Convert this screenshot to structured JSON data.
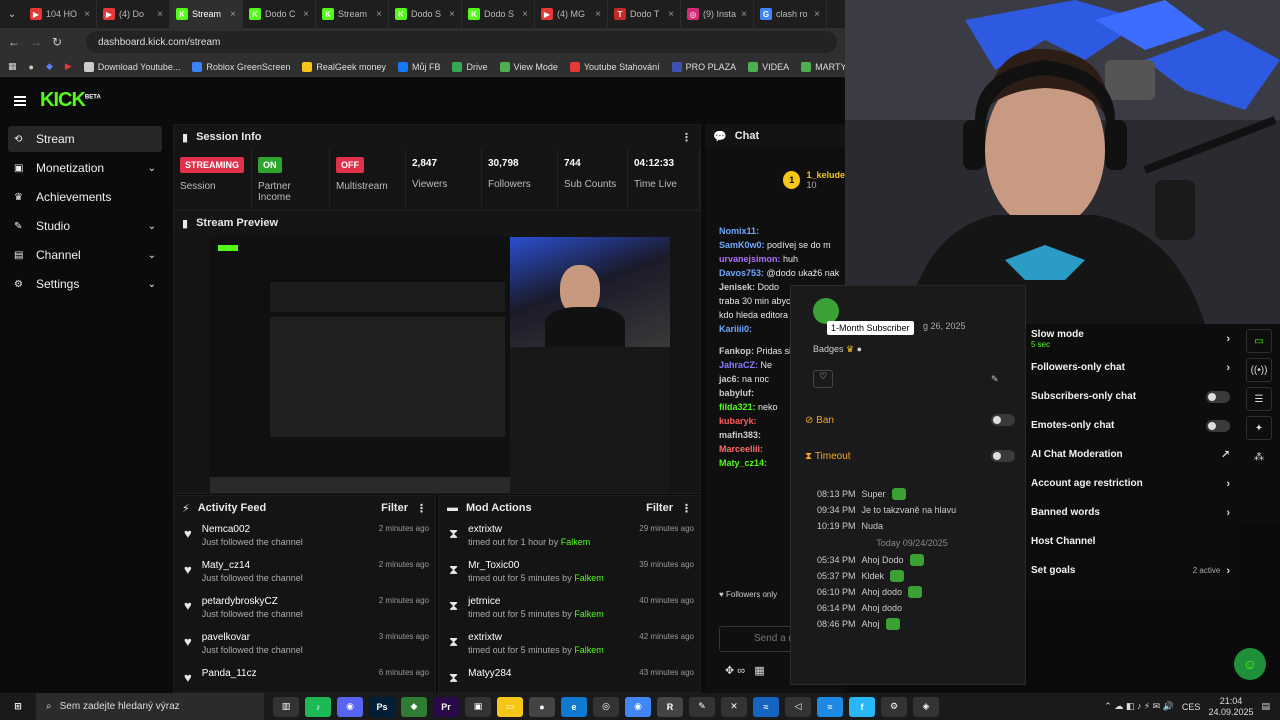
{
  "tabs": [
    {
      "label": "104 HO",
      "color": "#e53935",
      "glyph": "▶"
    },
    {
      "label": "(4) Do",
      "color": "#e53935",
      "glyph": "▶"
    },
    {
      "label": "Stream",
      "color": "#53fc18",
      "glyph": "K",
      "active": true
    },
    {
      "label": "Dodo C",
      "color": "#53fc18",
      "glyph": "K"
    },
    {
      "label": "Stream",
      "color": "#53fc18",
      "glyph": "K"
    },
    {
      "label": "Dodo S",
      "color": "#53fc18",
      "glyph": "K"
    },
    {
      "label": "Dodo S",
      "color": "#53fc18",
      "glyph": "K"
    },
    {
      "label": "(4) MG",
      "color": "#e53935",
      "glyph": "▶"
    },
    {
      "label": "Dodo T",
      "color": "#c62828",
      "glyph": "T"
    },
    {
      "label": "(9) Insta",
      "color": "#d62976",
      "glyph": "◎"
    },
    {
      "label": "clash ro",
      "color": "#4285f4",
      "glyph": "G"
    }
  ],
  "url": "dashboard.kick.com/stream",
  "bookmarks": [
    "Download Youtube...",
    "Roblox GreenScreen",
    "RealGeek money",
    "Můj FB",
    "Drive",
    "View Mode",
    "Youtube Stahování",
    "PRO PLAZA",
    "VIDEA",
    "MARTY UKO"
  ],
  "sidebar": [
    {
      "label": "Stream",
      "icon": "⟲",
      "sel": true,
      "chev": false
    },
    {
      "label": "Monetization",
      "icon": "▣",
      "chev": true
    },
    {
      "label": "Achievements",
      "icon": "♛",
      "chev": false
    },
    {
      "label": "Studio",
      "icon": "✎",
      "chev": true
    },
    {
      "label": "Channel",
      "icon": "▤",
      "chev": true
    },
    {
      "label": "Settings",
      "icon": "⚙",
      "chev": true
    }
  ],
  "session": {
    "title": "Session Info",
    "stats": [
      {
        "pill": "STREAMING",
        "pillColor": "#e0304a",
        "label": "Session"
      },
      {
        "pill": "ON",
        "pillColor": "#2ea62e",
        "label": "Partner Income"
      },
      {
        "pill": "OFF",
        "pillColor": "#e0304a",
        "label": "Multistream"
      },
      {
        "value": "2,847",
        "label": "Viewers"
      },
      {
        "value": "30,798",
        "label": "Followers"
      },
      {
        "value": "744",
        "label": "Sub Counts"
      },
      {
        "value": "04:12:33",
        "label": "Time Live"
      }
    ]
  },
  "preview": {
    "title": "Stream Preview"
  },
  "activity": {
    "title": "Activity Feed",
    "filter": "Filter",
    "rows": [
      {
        "name": "Nemca002",
        "sub": "Just followed the channel",
        "time": "2 minutes ago"
      },
      {
        "name": "Maty_cz14",
        "sub": "Just followed the channel",
        "time": "2 minutes ago"
      },
      {
        "name": "petardybroskyCZ",
        "sub": "Just followed the channel",
        "time": "2 minutes ago"
      },
      {
        "name": "pavelkovar",
        "sub": "Just followed the channel",
        "time": "3 minutes ago"
      },
      {
        "name": "Panda_11cz",
        "sub": "",
        "time": "6 minutes ago"
      }
    ]
  },
  "mod": {
    "title": "Mod Actions",
    "filter": "Filter",
    "rows": [
      {
        "name": "extrixtw",
        "pre": "timed out for 1 hour by",
        "by": "Falkem",
        "time": "29 minutes ago"
      },
      {
        "name": "Mr_Toxic00",
        "pre": "timed out for 5 minutes by",
        "by": "Falkem",
        "time": "39 minutes ago"
      },
      {
        "name": "jetrnice",
        "pre": "timed out for 5 minutes by",
        "by": "Falkem",
        "time": "40 minutes ago"
      },
      {
        "name": "extrixtw",
        "pre": "timed out for 5 minutes by",
        "by": "Falkem",
        "time": "42 minutes ago"
      },
      {
        "name": "Matyy284",
        "pre": "",
        "by": "",
        "time": "43 minutes ago"
      }
    ]
  },
  "chat": {
    "title": "Chat",
    "pinned_user": "1_kelude",
    "pinned_count": "10",
    "lines": [
      {
        "user": "Nomix11:",
        "color": "#6ea8ff",
        "text": ""
      },
      {
        "user": "SamK0w0:",
        "color": "#6ea8ff",
        "text": "podívej se do m"
      },
      {
        "user": "urvanejsimon:",
        "color": "#b06cff",
        "text": "huh"
      },
      {
        "user": "Davos753:",
        "color": "#6ea8ff",
        "text": "@dodo ukaž6 nak"
      },
      {
        "user": "Jenisek:",
        "color": "#ccc",
        "text": "Dodo"
      },
      {
        "user": "",
        "color": "#ccc",
        "text": "traba 30 min abyc"
      },
      {
        "user": "",
        "color": "#ccc",
        "text": "kdo hleda editora"
      },
      {
        "user": "Kariiii0:",
        "color": "#6ea8ff",
        "text": ""
      },
      {
        "user": "",
        "color": "#ccc",
        "text": ""
      },
      {
        "user": "",
        "color": "#ccc",
        "text": ""
      },
      {
        "user": "Fankop:",
        "color": "#ccc",
        "text": "Pridas si"
      },
      {
        "user": "JahraCZ:",
        "color": "#8a7cff",
        "text": "Ne"
      },
      {
        "user": "jac6:",
        "color": "#ccc",
        "text": "na noc"
      },
      {
        "user": "babyluf:",
        "color": "#ccc",
        "text": ""
      },
      {
        "user": "filda321:",
        "color": "#53fc18",
        "text": "neko"
      },
      {
        "user": "kubaryk:",
        "color": "#ff5a5a",
        "text": ""
      },
      {
        "user": "mafin383:",
        "color": "#ccc",
        "text": ""
      },
      {
        "user": "Marceeliii:",
        "color": "#ff6b6b",
        "text": ""
      },
      {
        "user": "Maty_cz14:",
        "color": "#53fc18",
        "text": ""
      }
    ],
    "followers_only": "Followers only",
    "send_placeholder": "Send a m"
  },
  "popup": {
    "tooltip": "1-Month Subscriber",
    "date": "g 26, 2025",
    "badges": "Badges",
    "ban": "Ban",
    "timeout": "Timeout",
    "today": "Today 09/24/2025",
    "msgs": [
      {
        "time": "08:13 PM",
        "text": "Super"
      },
      {
        "time": "09:34 PM",
        "text": "Je to takzvaně na hlavu"
      },
      {
        "time": "10:19 PM",
        "text": "Nuda"
      },
      {
        "time": "05:34 PM",
        "text": "Ahoj Dodo"
      },
      {
        "time": "05:37 PM",
        "text": "Kldek"
      },
      {
        "time": "06:10 PM",
        "text": "Ahoj dodo"
      },
      {
        "time": "06:14 PM",
        "text": "Ahoj dodo"
      },
      {
        "time": "08:46 PM",
        "text": "Ahoj"
      }
    ]
  },
  "settings": [
    {
      "label": "Slow mode",
      "sub": "5 sec",
      "ctrl": "chev"
    },
    {
      "label": "Followers-only chat",
      "ctrl": "chev"
    },
    {
      "label": "Subscribers-only chat",
      "ctrl": "toggle"
    },
    {
      "label": "Emotes-only chat",
      "ctrl": "toggle"
    },
    {
      "label": "AI Chat Moderation",
      "ctrl": "ext"
    },
    {
      "label": "Account age restriction",
      "ctrl": "chev"
    },
    {
      "label": "Banned words",
      "ctrl": "chev"
    },
    {
      "label": "Host Channel",
      "ctrl": "none"
    },
    {
      "label": "Set goals",
      "ctrl": "chev",
      "sub": "2 active"
    }
  ],
  "taskbar": {
    "search_placeholder": "Sem zadejte hledaný výraz",
    "time": "21:04",
    "date": "24.09.2025",
    "lang": "CES"
  }
}
